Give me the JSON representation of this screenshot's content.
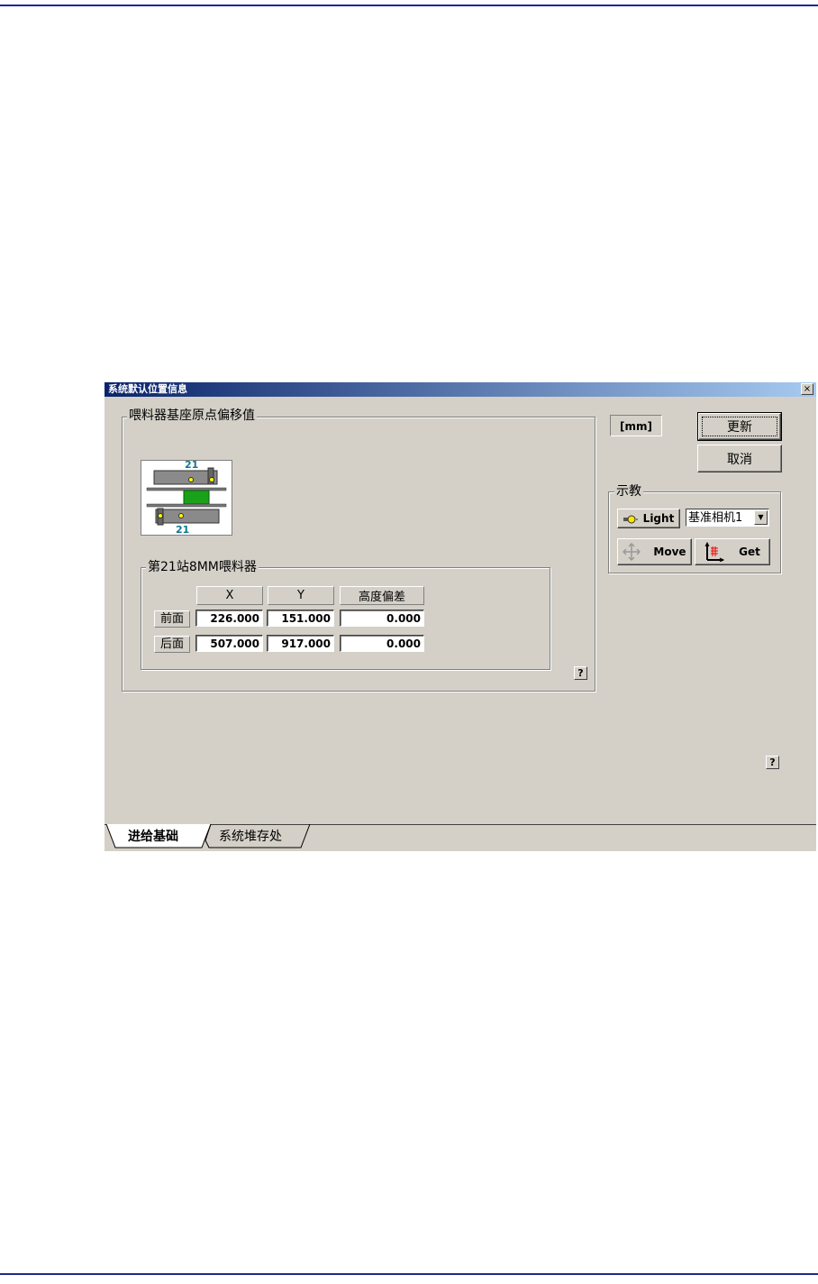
{
  "window": {
    "title": "系统默认位置信息",
    "close_label": "×"
  },
  "feeder_group": {
    "legend": "喂料器基座原点偏移值",
    "diagram_top_label": "21",
    "diagram_bottom_label": "21"
  },
  "station_group": {
    "legend": "第21站8MM喂料器",
    "columns": [
      "X",
      "Y",
      "高度偏差"
    ],
    "rows": [
      {
        "label": "前面",
        "x": "226.000",
        "y": "151.000",
        "height": "0.000"
      },
      {
        "label": "后面",
        "x": "507.000",
        "y": "917.000",
        "height": "0.000"
      }
    ]
  },
  "unit_label": "[mm]",
  "buttons": {
    "update": "更新",
    "cancel": "取消"
  },
  "teach_group": {
    "legend": "示教",
    "light_label": "Light",
    "camera_selected": "基准相机1",
    "move_label": "Move",
    "get_label": "Get"
  },
  "help_label": "?",
  "tabs": [
    {
      "label": "进给基础"
    },
    {
      "label": "系统堆存处"
    }
  ],
  "colors": {
    "title_start": "#0a246a",
    "title_end": "#a6caf0",
    "dialog_bg": "#d4d0c8",
    "rule": "#1a2a8a"
  }
}
